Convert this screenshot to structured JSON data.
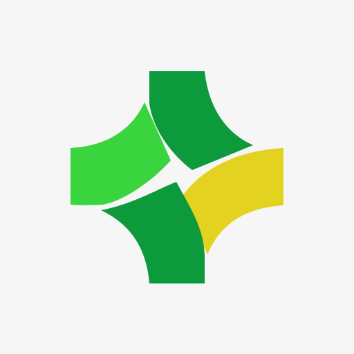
{
  "logo": {
    "icon": "four-petal-cross-logo",
    "colors": {
      "background": "#f6f6f6",
      "dark_green": "#0c9a3c",
      "light_green": "#3ad43e",
      "yellow": "#e3d21f"
    }
  }
}
